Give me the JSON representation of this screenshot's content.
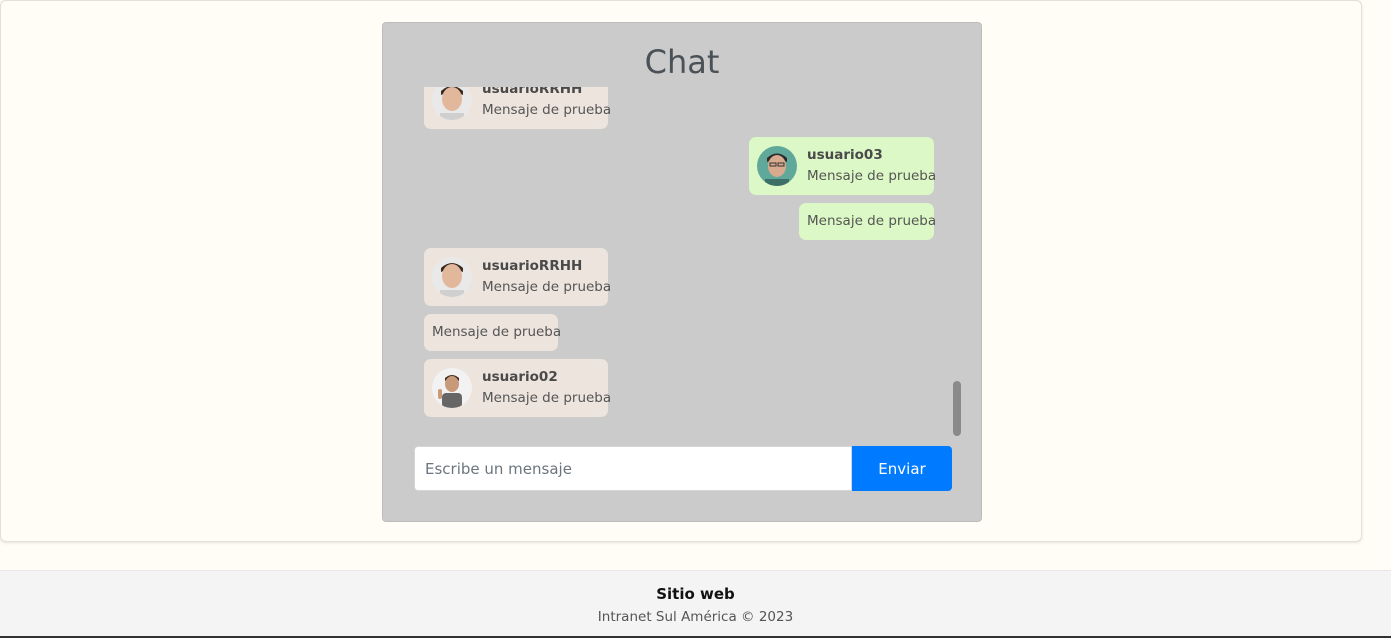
{
  "chat": {
    "title": "Chat",
    "messages": [
      {
        "user": "usuarioRRHH",
        "text": "Mensaje de prueba"
      },
      {
        "user": "usuario03",
        "text": "Mensaje de prueba"
      },
      {
        "text": "Mensaje de prueba"
      },
      {
        "user": "usuarioRRHH",
        "text": "Mensaje de prueba"
      },
      {
        "text": "Mensaje de prueba"
      },
      {
        "user": "usuario02",
        "text": "Mensaje de prueba"
      }
    ],
    "input_placeholder": "Escribe un mensaje",
    "send_label": "Enviar"
  },
  "footer": {
    "title": "Sitio web",
    "copyright": "Intranet Sul América © 2023"
  },
  "colors": {
    "own_bubble": "#dcf8c6",
    "other_bubble": "#ece4dd",
    "send_button": "#007bff"
  }
}
